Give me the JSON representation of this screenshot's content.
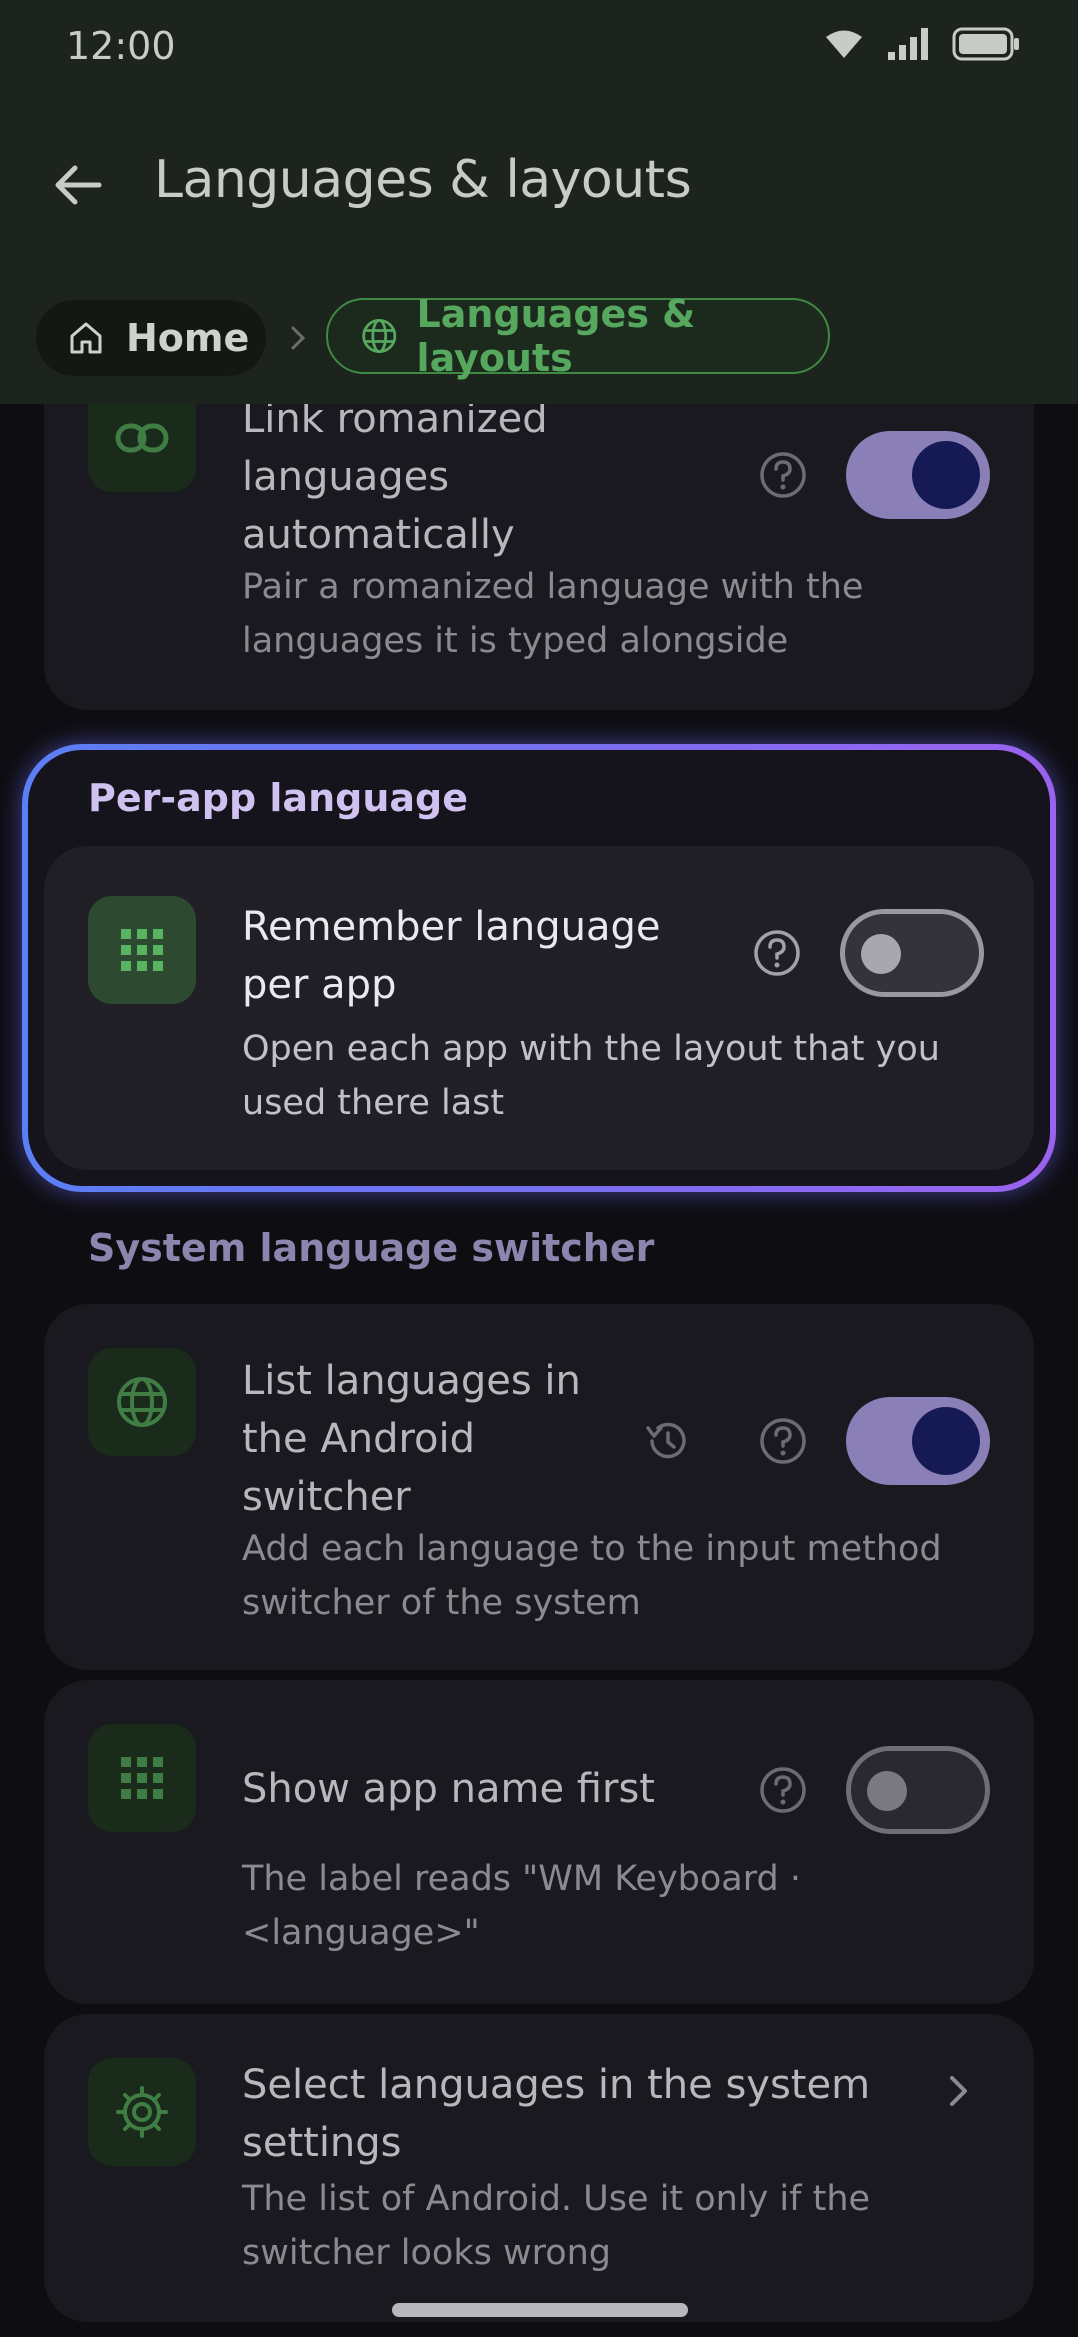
{
  "status_bar": {
    "time": "12:00"
  },
  "header": {
    "title": "Languages & layouts",
    "breadcrumb": {
      "home_label": "Home",
      "current_label": "Languages & layouts"
    }
  },
  "top_card": {
    "title_lines": [
      "Link romanized",
      "languages",
      "automatically"
    ],
    "subtitle_lines": [
      "Pair a romanized language with the",
      "languages it is typed alongside"
    ],
    "toggle_on": true
  },
  "per_app_section": {
    "heading": "Per-app language",
    "item": {
      "title_lines": [
        "Remember language",
        "per app"
      ],
      "subtitle_lines": [
        "Open each app with the layout that you",
        "used there last"
      ],
      "toggle_on": false
    }
  },
  "system_section": {
    "heading": "System language switcher",
    "items": [
      {
        "title_lines": [
          "List languages in",
          "the Android",
          "switcher"
        ],
        "subtitle_lines": [
          "Add each language to the input method",
          "switcher of the system"
        ],
        "toggle_on": true
      },
      {
        "title_lines": [
          "Show app name first"
        ],
        "subtitle_lines": [
          "The label reads \"WM Keyboard ·",
          "<language>\""
        ],
        "toggle_on": false
      },
      {
        "title_lines": [
          "Select languages in the system",
          "settings"
        ],
        "subtitle_lines": [
          "The list of Android. Use it only if the",
          "switcher looks wrong"
        ]
      }
    ]
  },
  "icons": {
    "link": "link-icon",
    "grid": "grid-icon",
    "globe": "globe-icon",
    "gear": "gear-icon",
    "help": "help-icon",
    "history": "history-icon",
    "chevron": "chevron-right-icon"
  },
  "colors": {
    "accent_green": "#57a85f",
    "toggle_on": "#8a7fb7",
    "highlight_start": "#5b7ff5",
    "highlight_end": "#9b63ef"
  }
}
